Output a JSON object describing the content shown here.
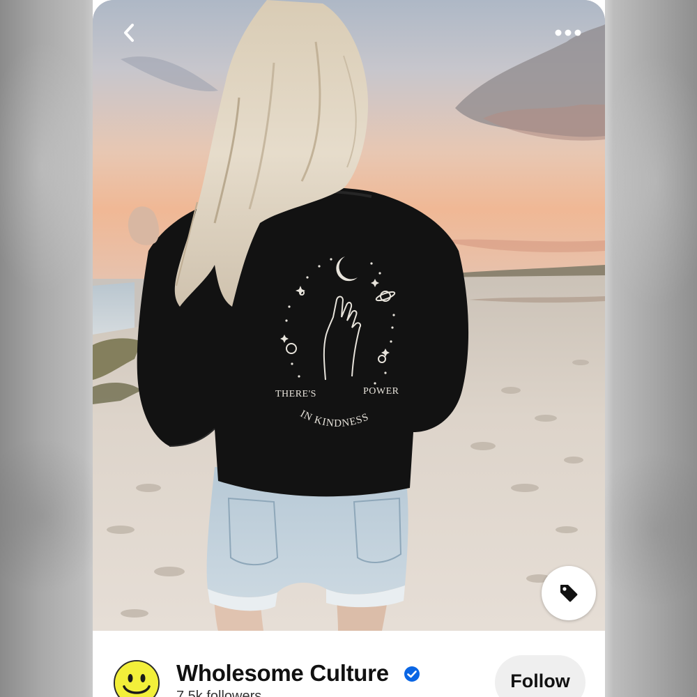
{
  "pin": {
    "image_alt": "Woman on a beach wearing a black sweatshirt with a hand, moon and stars design",
    "print": {
      "line1_left": "THERE'S",
      "line1_right": "POWER",
      "line2": "IN KINDNESS"
    }
  },
  "toolbar": {
    "back_icon": "chevron-left-icon",
    "more_icon": "ellipsis-icon",
    "shop_icon": "tag-icon"
  },
  "creator": {
    "name": "Wholesome Culture",
    "followers": "7.5k followers",
    "verified": true,
    "avatar_icon": "smiley-face-icon",
    "avatar_color": "#f2ef3a",
    "verified_color": "#0a66e4"
  },
  "actions": {
    "follow_label": "Follow"
  }
}
